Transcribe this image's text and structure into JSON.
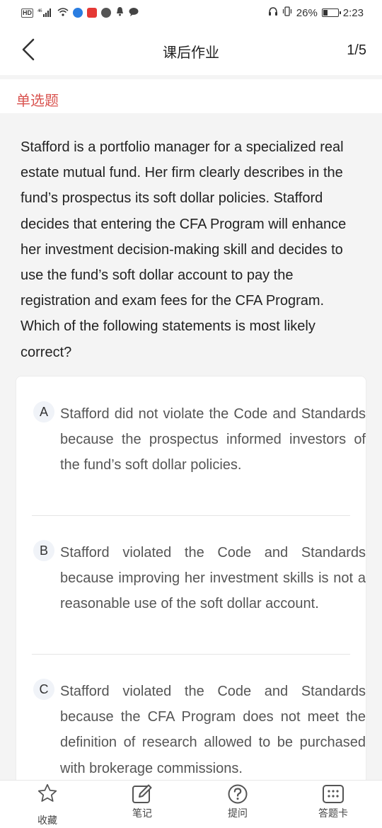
{
  "status_bar": {
    "hd": "HD",
    "signal": "46",
    "battery_percent": "26%",
    "time": "2:23"
  },
  "nav": {
    "title": "课后作业",
    "counter": "1/5"
  },
  "question_type": "单选题",
  "question": {
    "text": "Stafford is a portfolio manager for a specialized real estate mutual fund. Her firm clearly describes in the fund’s prospectus its soft dollar policies. Stafford decides that entering the CFA Program will enhance her investment decision-making skill and decides to use the fund’s soft dollar account to pay the registration and exam fees for the CFA Program. Which of the following statements is most likely correct?"
  },
  "options": [
    {
      "letter": "A",
      "text": "Stafford did not violate the Code and Standards because the prospectus informed investors of the fund’s soft dollar policies."
    },
    {
      "letter": "B",
      "text": "Stafford violated the Code and Standards because improving her investment skills is not a reasonable use of the soft dollar account."
    },
    {
      "letter": "C",
      "text": "Stafford violated the Code and Standards because the CFA Program does not meet the definition of research allowed to be purchased with brokerage commissions."
    }
  ],
  "tabs": [
    {
      "label": "收藏",
      "icon": "star-icon"
    },
    {
      "label": "笔记",
      "icon": "note-edit-icon"
    },
    {
      "label": "提问",
      "icon": "question-icon"
    },
    {
      "label": "答题卡",
      "icon": "answer-card-icon"
    }
  ],
  "colors": {
    "accent_red": "#d9534f",
    "background": "#f4f4f4",
    "card": "#ffffff"
  }
}
